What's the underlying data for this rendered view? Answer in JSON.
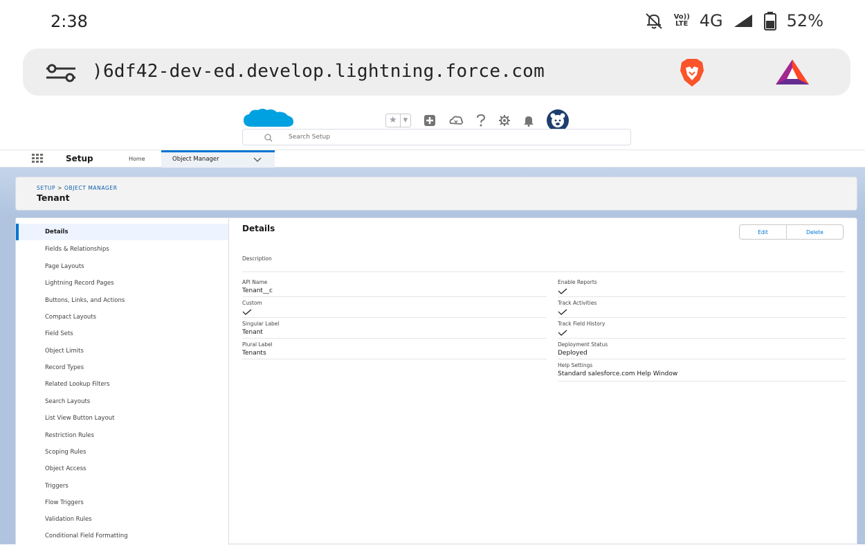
{
  "status_bar": {
    "time": "2:38",
    "volte_top": "Vo))",
    "volte_bottom": "LTE",
    "network": "4G",
    "battery": "52%"
  },
  "browser": {
    "url": ")6df42-dev-ed.develop.lightning.force.com"
  },
  "search": {
    "placeholder": "Search Setup"
  },
  "nav": {
    "app_name": "Setup",
    "home": "Home",
    "object_manager": "Object Manager"
  },
  "page_header": {
    "breadcrumb_setup": "SETUP",
    "breadcrumb_sep": " > ",
    "breadcrumb_object_manager": "OBJECT MANAGER",
    "title": "Tenant"
  },
  "sidebar": {
    "items": [
      {
        "label": "Details"
      },
      {
        "label": "Fields & Relationships"
      },
      {
        "label": "Page Layouts"
      },
      {
        "label": "Lightning Record Pages"
      },
      {
        "label": "Buttons, Links, and Actions"
      },
      {
        "label": "Compact Layouts"
      },
      {
        "label": "Field Sets"
      },
      {
        "label": "Object Limits"
      },
      {
        "label": "Record Types"
      },
      {
        "label": "Related Lookup Filters"
      },
      {
        "label": "Search Layouts"
      },
      {
        "label": "List View Button Layout"
      },
      {
        "label": "Restriction Rules"
      },
      {
        "label": "Scoping Rules"
      },
      {
        "label": "Object Access"
      },
      {
        "label": "Triggers"
      },
      {
        "label": "Flow Triggers"
      },
      {
        "label": "Validation Rules"
      },
      {
        "label": "Conditional Field Formatting"
      }
    ]
  },
  "details": {
    "title": "Details",
    "edit_label": "Edit",
    "delete_label": "Delete",
    "description_label": "Description",
    "api_name_label": "API Name",
    "api_name_value": "Tenant__c",
    "custom_label": "Custom",
    "singular_label_label": "Singular Label",
    "singular_label_value": "Tenant",
    "plural_label_label": "Plural Label",
    "plural_label_value": "Tenants",
    "enable_reports_label": "Enable Reports",
    "track_activities_label": "Track Activities",
    "track_field_history_label": "Track Field History",
    "deployment_status_label": "Deployment Status",
    "deployment_status_value": "Deployed",
    "help_settings_label": "Help Settings",
    "help_settings_value": "Standard salesforce.com Help Window"
  },
  "colors": {
    "brand_blue": "#0176d3",
    "background_blue": "#b0c4df",
    "salesforce_cloud": "#00a1e0"
  }
}
